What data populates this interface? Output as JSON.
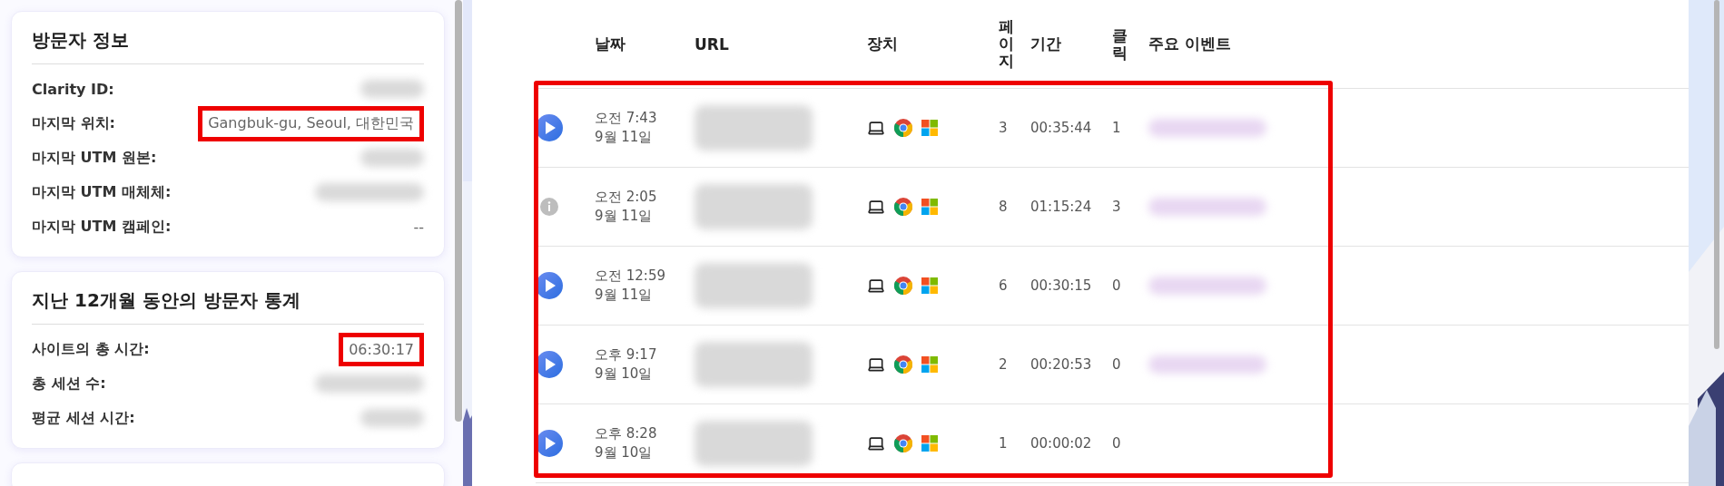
{
  "visitor_info": {
    "title": "방문자 정보",
    "rows": [
      {
        "label": "Clarity ID:",
        "value_redacted": true
      },
      {
        "label": "마지막 위치:",
        "value": "Gangbuk-gu, Seoul, 대한민국",
        "highlighted": true
      },
      {
        "label": "마지막 UTM 원본:",
        "value_redacted": true
      },
      {
        "label": "마지막 UTM 매체체:",
        "value_redacted": true
      },
      {
        "label": "마지막 UTM 캠페인:",
        "value": "--",
        "highlighted": false
      }
    ]
  },
  "visitor_stats": {
    "title": "지난 12개월 동안의 방문자 통계",
    "rows": [
      {
        "label": "사이트의 총 시간:",
        "value": "06:30:17",
        "highlighted": true
      },
      {
        "label": "총 세션 수:",
        "value_redacted": true
      },
      {
        "label": "평균 세션 시간:",
        "value_redacted": true
      }
    ]
  },
  "sessions": {
    "highlighted": true,
    "columns": [
      {
        "label": "날짜",
        "vertical": false
      },
      {
        "label": "URL",
        "vertical": false
      },
      {
        "label": "장치",
        "vertical": false
      },
      {
        "label": "페이지",
        "vertical": true
      },
      {
        "label": "기간",
        "vertical": false
      },
      {
        "label": "클릭",
        "vertical": true
      },
      {
        "label": "주요 이벤트",
        "vertical": false
      }
    ],
    "rows": [
      {
        "kind": "play",
        "time": "오전 7:43",
        "date": "9월 11일",
        "pages": "3",
        "duration": "00:35:44",
        "clicks": "1",
        "has_events": true
      },
      {
        "kind": "info",
        "time": "오전 2:05",
        "date": "9월 11일",
        "pages": "8",
        "duration": "01:15:24",
        "clicks": "3",
        "has_events": true
      },
      {
        "kind": "play",
        "time": "오전 12:59",
        "date": "9월 11일",
        "pages": "6",
        "duration": "00:30:15",
        "clicks": "0",
        "has_events": true
      },
      {
        "kind": "play",
        "time": "오후 9:17",
        "date": "9월 10일",
        "pages": "2",
        "duration": "00:20:53",
        "clicks": "0",
        "has_events": true
      },
      {
        "kind": "play",
        "time": "오후 8:28",
        "date": "9월 10일",
        "pages": "1",
        "duration": "00:00:02",
        "clicks": "0",
        "has_events": false
      }
    ]
  }
}
